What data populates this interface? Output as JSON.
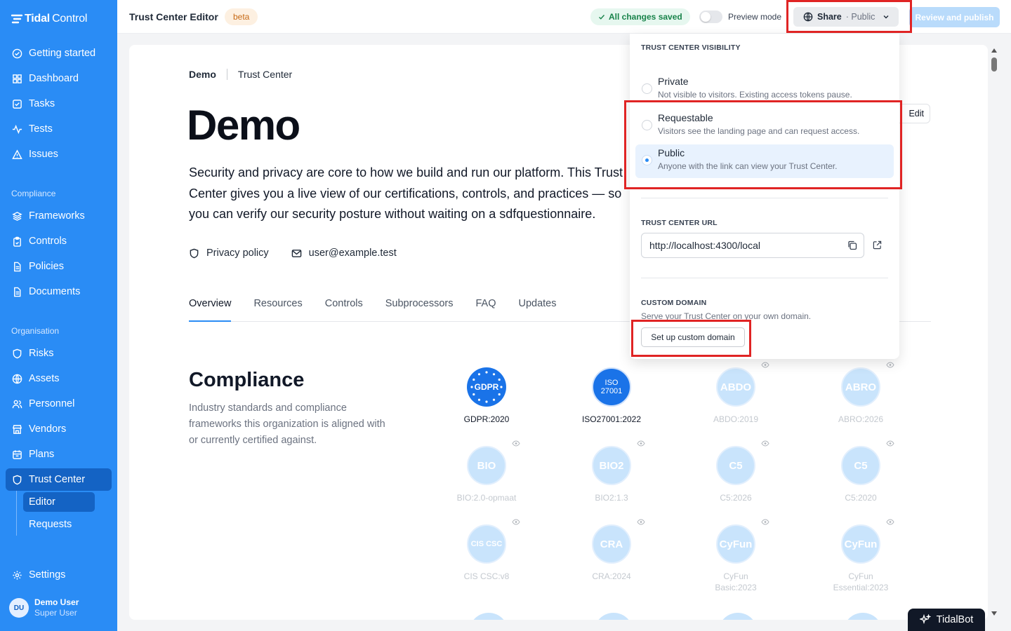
{
  "app": {
    "logo_bold": "Tidal",
    "logo_light": "Control"
  },
  "sidebar": {
    "items": [
      {
        "label": "Getting started",
        "icon": "check-circle-icon"
      },
      {
        "label": "Dashboard",
        "icon": "grid-icon"
      },
      {
        "label": "Tasks",
        "icon": "checkbox-icon"
      },
      {
        "label": "Tests",
        "icon": "activity-icon"
      },
      {
        "label": "Issues",
        "icon": "warning-icon"
      }
    ],
    "compliance_heading": "Compliance",
    "compliance_items": [
      {
        "label": "Frameworks",
        "icon": "layers-icon"
      },
      {
        "label": "Controls",
        "icon": "clipboard-icon"
      },
      {
        "label": "Policies",
        "icon": "file-icon"
      },
      {
        "label": "Documents",
        "icon": "file-icon"
      }
    ],
    "organisation_heading": "Organisation",
    "organisation_items": [
      {
        "label": "Risks",
        "icon": "shield-icon"
      },
      {
        "label": "Assets",
        "icon": "globe-icon"
      },
      {
        "label": "Personnel",
        "icon": "users-icon"
      },
      {
        "label": "Vendors",
        "icon": "store-icon"
      },
      {
        "label": "Plans",
        "icon": "calendar-icon"
      },
      {
        "label": "Trust Center",
        "icon": "shield-icon",
        "active": true
      }
    ],
    "sub_items": [
      {
        "label": "Editor",
        "active": true
      },
      {
        "label": "Requests"
      }
    ],
    "settings_label": "Settings",
    "user": {
      "initials": "DU",
      "name": "Demo User",
      "role": "Super User"
    }
  },
  "topbar": {
    "title": "Trust Center Editor",
    "beta": "beta",
    "saved": "All changes saved",
    "preview_label": "Preview mode",
    "share_label": "Share",
    "share_visibility": "· Public",
    "publish_label": "Review and publish"
  },
  "page": {
    "breadcrumb_org": "Demo",
    "breadcrumb_page": "Trust Center",
    "title": "Demo",
    "desc_line1": "Security and privacy are core to how we build and run our platform. This Trust",
    "desc_line2": "Center gives you a live view of our certifications, controls, and practices — so",
    "desc_line3": "you can verify our security posture without waiting on a sdfquestionnaire.",
    "edit_label": "Edit",
    "privacy_label": "Privacy policy",
    "email": "user@example.test",
    "tabs": [
      "Overview",
      "Resources",
      "Controls",
      "Subprocessors",
      "FAQ",
      "Updates"
    ],
    "compliance_title": "Compliance",
    "compliance_desc": "Industry standards and compliance frameworks this organization is aligned with or currently certified against.",
    "frameworks": [
      {
        "badge": "GDPR",
        "label": "GDPR:2020",
        "active": true,
        "color": "#1a73e8"
      },
      {
        "badge": "ISO 27001",
        "label": "ISO27001:2022",
        "active": true,
        "color": "#1a73e8"
      },
      {
        "badge": "ABDO",
        "label": "ABDO:2019"
      },
      {
        "badge": "ABRO",
        "label": "ABRO:2026"
      },
      {
        "badge": "BIO",
        "label": "BIO:2.0-opmaat"
      },
      {
        "badge": "BIO2",
        "label": "BIO2:1.3"
      },
      {
        "badge": "C5",
        "label": "C5:2026"
      },
      {
        "badge": "C5",
        "label": "C5:2020"
      },
      {
        "badge": "CIS CSC",
        "label": "CIS CSC:v8"
      },
      {
        "badge": "CRA",
        "label": "CRA:2024"
      },
      {
        "badge": "CyFun",
        "label": "CyFun Basic:2023"
      },
      {
        "badge": "CyFun",
        "label": "CyFun Essential:2023"
      }
    ]
  },
  "dropdown": {
    "visibility_heading": "TRUST CENTER VISIBILITY",
    "options": [
      {
        "title": "Private",
        "desc": "Not visible to visitors. Existing access tokens pause."
      },
      {
        "title": "Requestable",
        "desc": "Visitors see the landing page and can request access."
      },
      {
        "title": "Public",
        "desc": "Anyone with the link can view your Trust Center.",
        "selected": true
      }
    ],
    "url_heading": "TRUST CENTER URL",
    "url": "http://localhost:4300/local",
    "custom_heading": "CUSTOM DOMAIN",
    "custom_desc": "Serve your Trust Center on your own domain.",
    "custom_button": "Set up custom domain"
  },
  "tidalbot_label": "TidalBot",
  "colors": {
    "brand": "#2a8cf5",
    "brand_dark": "#1463c4",
    "highlight": "#e02424"
  }
}
